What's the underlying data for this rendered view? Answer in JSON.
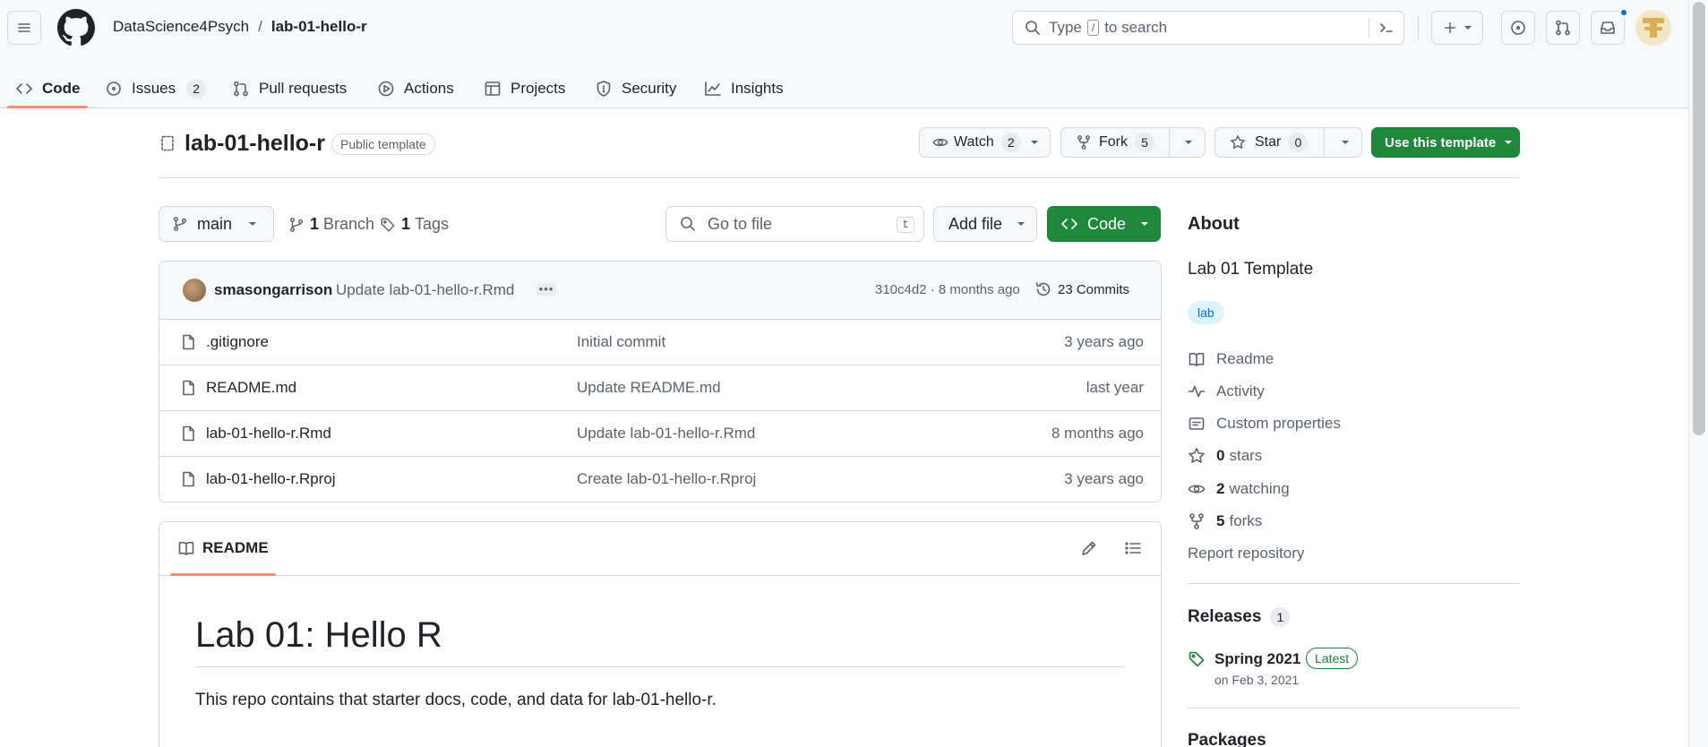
{
  "header": {
    "owner": "DataScience4Psych",
    "separator": "/",
    "repo": "lab-01-hello-r",
    "search_prefix": "Type",
    "search_key": "/",
    "search_suffix": "to search"
  },
  "tabs": [
    {
      "label": "Code",
      "count": ""
    },
    {
      "label": "Issues",
      "count": "2"
    },
    {
      "label": "Pull requests",
      "count": ""
    },
    {
      "label": "Actions",
      "count": ""
    },
    {
      "label": "Projects",
      "count": ""
    },
    {
      "label": "Security",
      "count": ""
    },
    {
      "label": "Insights",
      "count": ""
    }
  ],
  "repo": {
    "title": "lab-01-hello-r",
    "visibility": "Public template",
    "watch_label": "Watch",
    "watch_count": "2",
    "fork_label": "Fork",
    "fork_count": "5",
    "star_label": "Star",
    "star_count": "0",
    "template_button": "Use this template"
  },
  "toolbar": {
    "branch": "main",
    "branch_count": "1",
    "branch_label": "Branch",
    "tag_count": "1",
    "tag_label": "Tags",
    "goto_placeholder": "Go to file",
    "goto_key": "t",
    "add_file": "Add file",
    "code_button": "Code"
  },
  "commit": {
    "author": "smasongarrison",
    "message": "Update lab-01-hello-r.Rmd",
    "hash_time": "310c4d2 · 8 months ago",
    "commits": "23 Commits"
  },
  "files": [
    {
      "name": ".gitignore",
      "message": "Initial commit",
      "age": "3 years ago"
    },
    {
      "name": "README.md",
      "message": "Update README.md",
      "age": "last year"
    },
    {
      "name": "lab-01-hello-r.Rmd",
      "message": "Update lab-01-hello-r.Rmd",
      "age": "8 months ago"
    },
    {
      "name": "lab-01-hello-r.Rproj",
      "message": "Create lab-01-hello-r.Rproj",
      "age": "3 years ago"
    }
  ],
  "readme": {
    "tab_label": "README",
    "heading": "Lab 01: Hello R",
    "body": "This repo contains that starter docs, code, and data for lab-01-hello-r."
  },
  "about": {
    "title": "About",
    "description": "Lab 01 Template",
    "topic": "lab",
    "readme": "Readme",
    "activity": "Activity",
    "custom": "Custom properties",
    "stars_n": "0",
    "stars": "stars",
    "watching_n": "2",
    "watching": "watching",
    "forks_n": "5",
    "forks": "forks",
    "report": "Report repository"
  },
  "releases": {
    "title": "Releases",
    "count": "1",
    "name": "Spring 2021",
    "badge": "Latest",
    "date": "on Feb 3, 2021"
  },
  "packages": {
    "title": "Packages"
  },
  "colors": {
    "green": "#1f883d",
    "accent_underline": "#fd8c73",
    "link_blue": "#0969da"
  }
}
